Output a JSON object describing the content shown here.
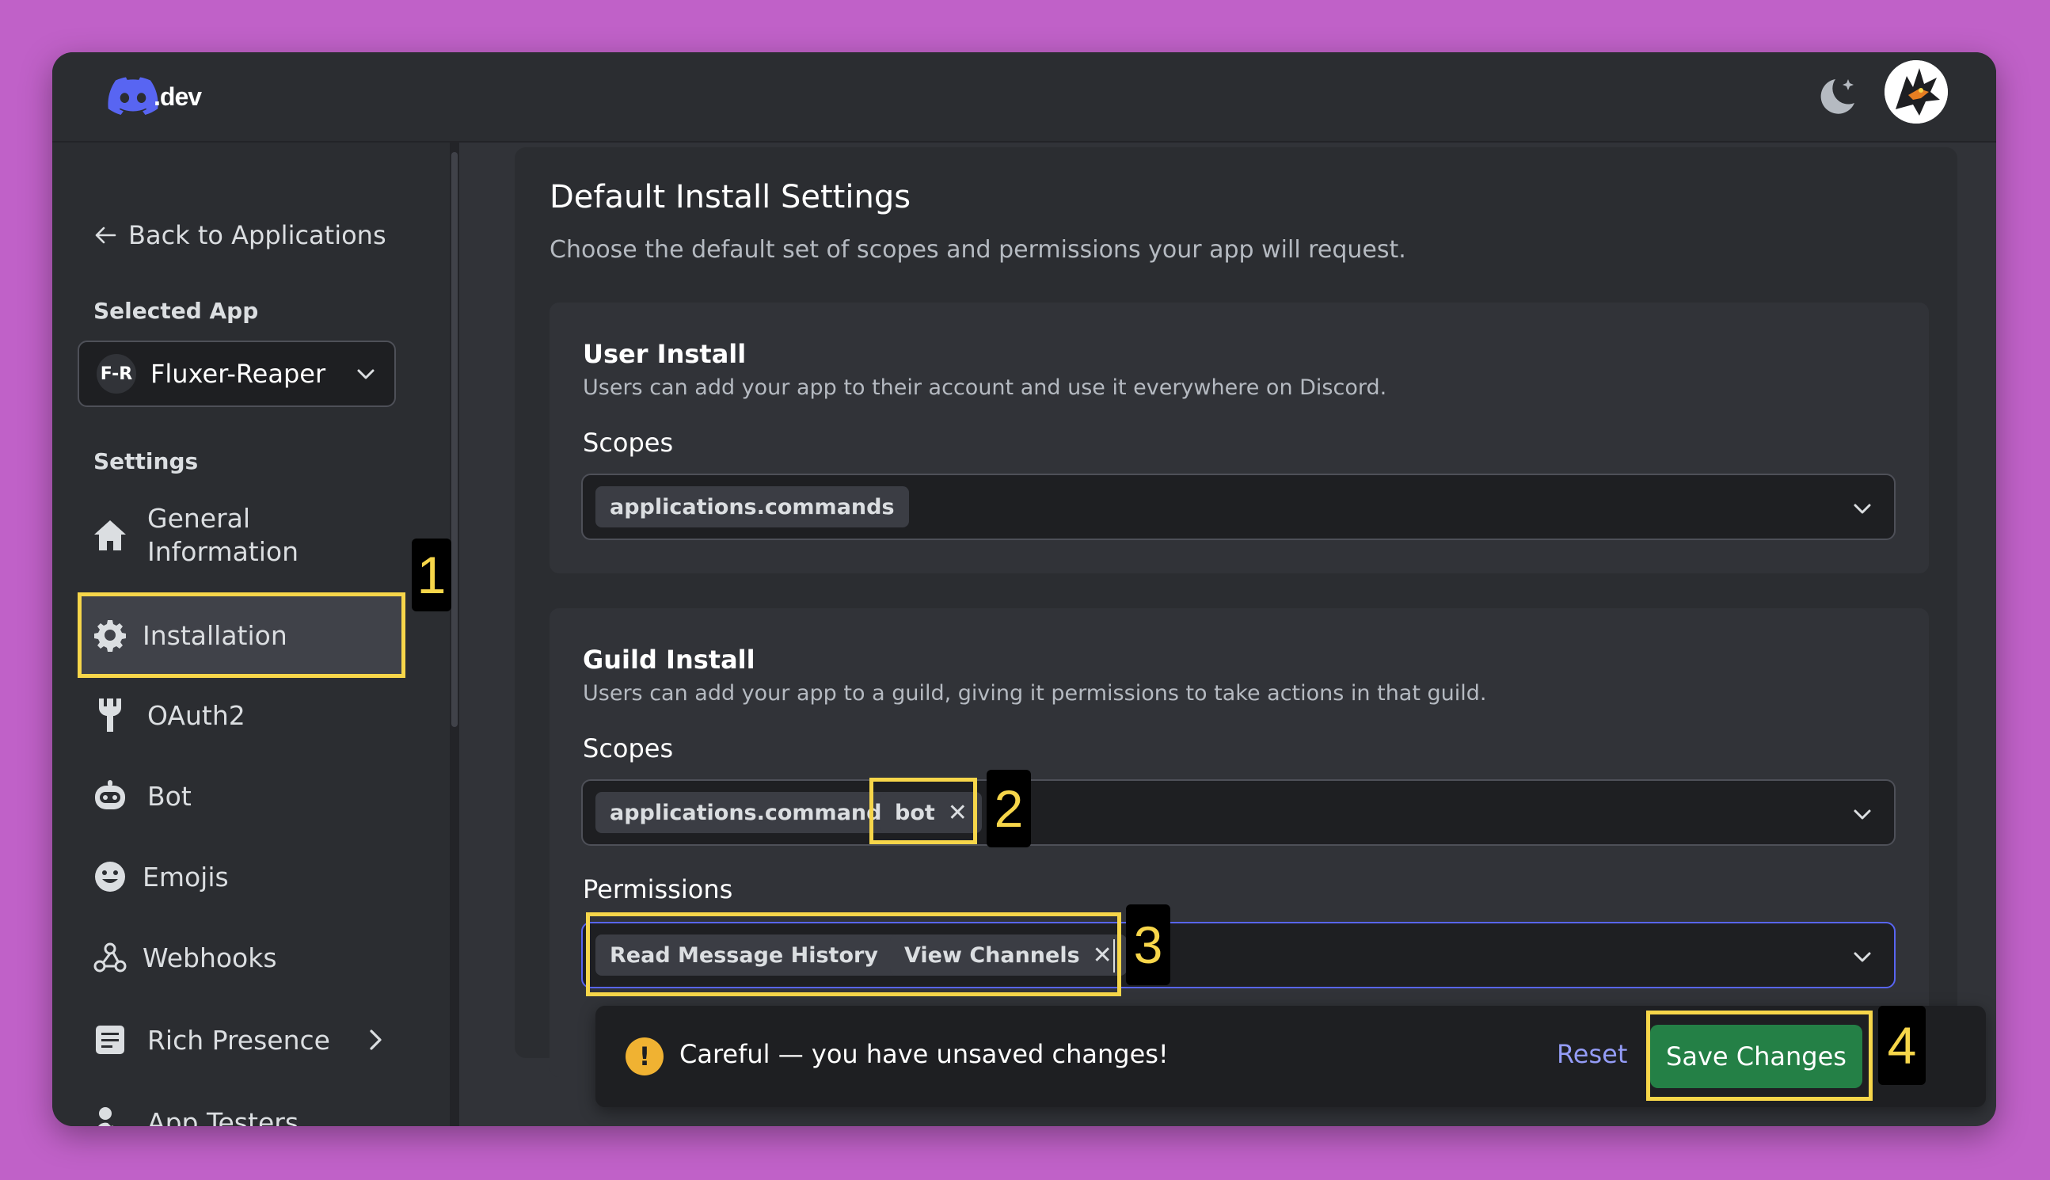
{
  "header": {
    "logo_text": ".dev",
    "theme_icon": "moon-sparkle-icon",
    "avatar_icon": "dragon-avatar"
  },
  "sidebar": {
    "back_label": "Back to Applications",
    "selected_app_label": "Selected App",
    "app_initials": "F-R",
    "app_name": "Fluxer-Reaper",
    "settings_label": "Settings",
    "items": [
      {
        "label": "General Information",
        "icon": "home-icon"
      },
      {
        "label": "Installation",
        "icon": "gear-icon",
        "active": true
      },
      {
        "label": "OAuth2",
        "icon": "wrench-icon"
      },
      {
        "label": "Bot",
        "icon": "bot-icon"
      },
      {
        "label": "Emojis",
        "icon": "emoji-icon"
      },
      {
        "label": "Webhooks",
        "icon": "webhook-icon"
      },
      {
        "label": "Rich Presence",
        "icon": "document-icon"
      },
      {
        "label": "App Testers",
        "icon": "user-icon"
      }
    ]
  },
  "main": {
    "title": "Default Install Settings",
    "subtitle": "Choose the default set of scopes and permissions your app will request.",
    "user_install": {
      "title": "User Install",
      "description": "Users can add your app to their account and use it everywhere on Discord.",
      "scopes_label": "Scopes",
      "scopes": [
        "applications.commands"
      ]
    },
    "guild_install": {
      "title": "Guild Install",
      "description": "Users can add your app to a guild, giving it permissions to take actions in that guild.",
      "scopes_label": "Scopes",
      "scopes": [
        "applications.commands",
        "bot"
      ],
      "permissions_label": "Permissions",
      "permissions": [
        "Read Message History",
        "View Channels"
      ]
    }
  },
  "notice": {
    "text": "Careful — you have unsaved changes!",
    "reset_label": "Reset",
    "save_label": "Save Changes"
  },
  "callouts": [
    "1",
    "2",
    "3",
    "4"
  ],
  "colors": {
    "background": "#c061c8",
    "highlight": "#f7d64a",
    "save_button": "#248046",
    "link": "#949cf7",
    "warning": "#f0b232"
  }
}
